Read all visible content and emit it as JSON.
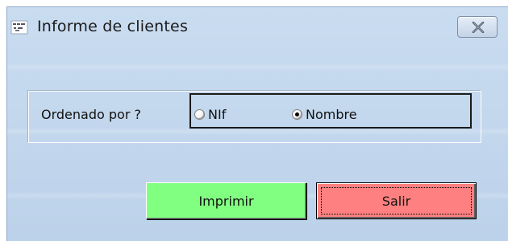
{
  "window": {
    "title": "Informe de clientes",
    "app_icon": "app-icon",
    "close_icon": "close-x-icon"
  },
  "group": {
    "label": "Ordenado por ?",
    "options": [
      {
        "label": "NIf",
        "checked": false
      },
      {
        "label": "Nombre",
        "checked": true
      }
    ]
  },
  "buttons": {
    "print_label": "Imprimir",
    "exit_label": "Salir"
  },
  "colors": {
    "print_bg": "#80ff80",
    "exit_bg": "#ff8080",
    "window_bg": "#c9dcf0"
  }
}
